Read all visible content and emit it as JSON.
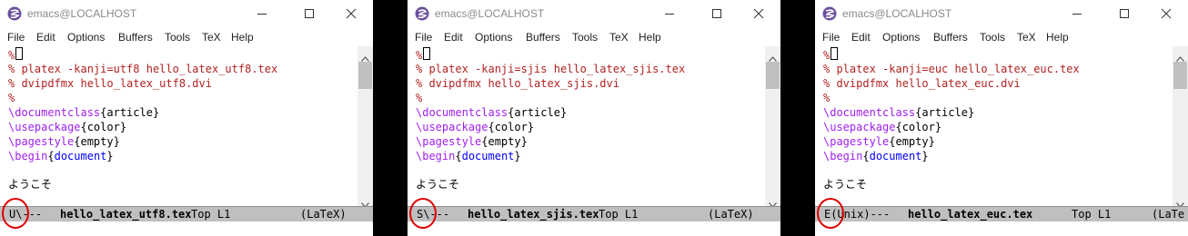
{
  "windows": [
    {
      "id": "utf8",
      "title": "emacs@LOCALHOST",
      "menu": [
        "File",
        "Edit",
        "Options",
        "Buffers",
        "Tools",
        "TeX",
        "Help"
      ],
      "lines": [
        {
          "t": "c",
          "text": "%"
        },
        {
          "t": "c",
          "text": "% platex -kanji=utf8 hello_latex_utf8.tex"
        },
        {
          "t": "c",
          "text": "% dvipdfmx hello_latex_utf8.dvi"
        },
        {
          "t": "c",
          "text": "%"
        },
        {
          "t": "cmd",
          "cmd": "\\documentclass",
          "arg": "{article}",
          "argc": ""
        },
        {
          "t": "cmd",
          "cmd": "\\usepackage",
          "arg": "{color}",
          "argc": ""
        },
        {
          "t": "cmd",
          "cmd": "\\pagestyle",
          "arg": "{empty}",
          "argc": ""
        },
        {
          "t": "cmd",
          "cmd": "\\begin",
          "arg": "document",
          "argc": "fn"
        }
      ],
      "body_text": "ようこそ",
      "modeline": {
        "status": "U\\---",
        "buffer": "hello_latex_utf8.tex",
        "pos": "Top L1",
        "mode": "(LaTeX)"
      }
    },
    {
      "id": "sjis",
      "title": "emacs@LOCALHOST",
      "menu": [
        "File",
        "Edit",
        "Options",
        "Buffers",
        "Tools",
        "TeX",
        "Help"
      ],
      "lines": [
        {
          "t": "c",
          "text": "%"
        },
        {
          "t": "c",
          "text": "% platex -kanji=sjis hello_latex_sjis.tex"
        },
        {
          "t": "c",
          "text": "% dvipdfmx hello_latex_sjis.dvi"
        },
        {
          "t": "c",
          "text": "%"
        },
        {
          "t": "cmd",
          "cmd": "\\documentclass",
          "arg": "{article}",
          "argc": ""
        },
        {
          "t": "cmd",
          "cmd": "\\usepackage",
          "arg": "{color}",
          "argc": ""
        },
        {
          "t": "cmd",
          "cmd": "\\pagestyle",
          "arg": "{empty}",
          "argc": ""
        },
        {
          "t": "cmd",
          "cmd": "\\begin",
          "arg": "document",
          "argc": "fn"
        }
      ],
      "body_text": "ようこそ",
      "modeline": {
        "status": "S\\---",
        "buffer": "hello_latex_sjis.tex",
        "pos": "Top L1",
        "mode": "(LaTeX)"
      }
    },
    {
      "id": "euc",
      "title": "emacs@LOCALHOST",
      "menu": [
        "File",
        "Edit",
        "Options",
        "Buffers",
        "Tools",
        "TeX",
        "Help"
      ],
      "lines": [
        {
          "t": "c",
          "text": "%"
        },
        {
          "t": "c",
          "text": "% platex -kanji=euc hello_latex_euc.tex"
        },
        {
          "t": "c",
          "text": "% dvipdfmx hello_latex_euc.dvi"
        },
        {
          "t": "c",
          "text": "%"
        },
        {
          "t": "cmd",
          "cmd": "\\documentclass",
          "arg": "{article}",
          "argc": ""
        },
        {
          "t": "cmd",
          "cmd": "\\usepackage",
          "arg": "{color}",
          "argc": ""
        },
        {
          "t": "cmd",
          "cmd": "\\pagestyle",
          "arg": "{empty}",
          "argc": ""
        },
        {
          "t": "cmd",
          "cmd": "\\begin",
          "arg": "document",
          "argc": "fn"
        }
      ],
      "body_text": "ようこそ",
      "modeline": {
        "status": "E(Unix)---",
        "buffer": "hello_latex_euc.tex",
        "pos": "Top L1",
        "mode": "(LaTe"
      }
    }
  ],
  "colors": {
    "comment": "#b22222",
    "keyword": "#a020f0",
    "function": "#0000ff",
    "highlight_circle": "#e00000"
  }
}
